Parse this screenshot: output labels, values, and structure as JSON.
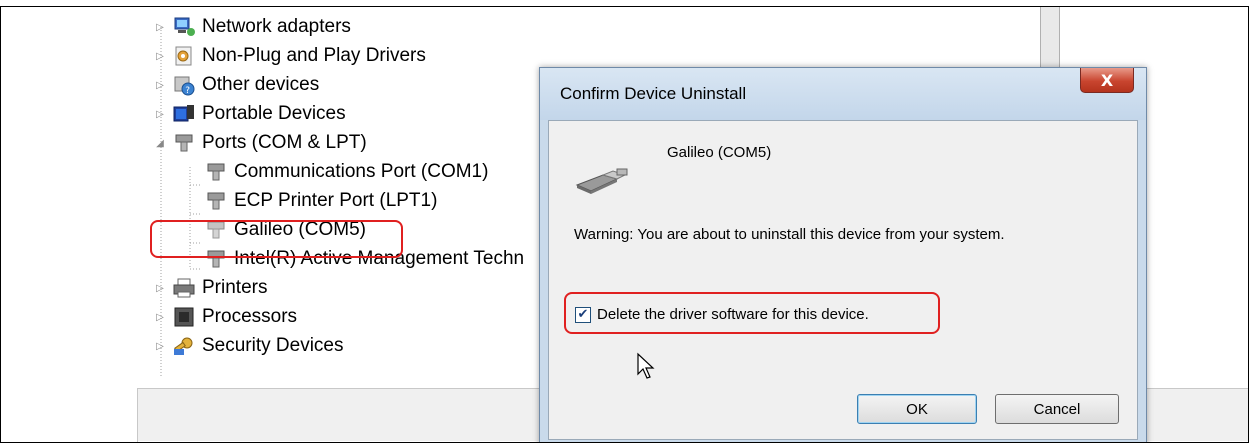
{
  "device_manager": {
    "tree_items": [
      {
        "label": "Network adapters",
        "icon": "network-adapter-icon"
      },
      {
        "label": "Non-Plug and Play Drivers",
        "icon": "driver-icon"
      },
      {
        "label": "Other devices",
        "icon": "unknown-device-icon"
      },
      {
        "label": "Portable Devices",
        "icon": "portable-device-icon"
      },
      {
        "label": "Ports (COM & LPT)",
        "icon": "port-icon"
      },
      {
        "label": "Communications Port (COM1)",
        "icon": "port-icon"
      },
      {
        "label": "ECP Printer Port (LPT1)",
        "icon": "port-icon"
      },
      {
        "label": "Galileo (COM5)",
        "icon": "port-icon"
      },
      {
        "label": "Intel(R) Active Management Techn",
        "icon": "port-icon"
      },
      {
        "label": "Printers",
        "icon": "printer-icon"
      },
      {
        "label": "Processors",
        "icon": "processor-icon"
      },
      {
        "label": "Security Devices",
        "icon": "security-device-icon"
      }
    ]
  },
  "dialog": {
    "title": "Confirm Device Uninstall",
    "close_label": "X",
    "device_name": "Galileo (COM5)",
    "warning": "Warning: You are about to uninstall this device from your system.",
    "checkbox_label": "Delete the driver software for this device.",
    "checkbox_checked": true,
    "ok_label": "OK",
    "cancel_label": "Cancel"
  },
  "colors": {
    "highlight": "#e02020",
    "title_bar": "#c9daeb",
    "close_button": "#c9452f"
  }
}
